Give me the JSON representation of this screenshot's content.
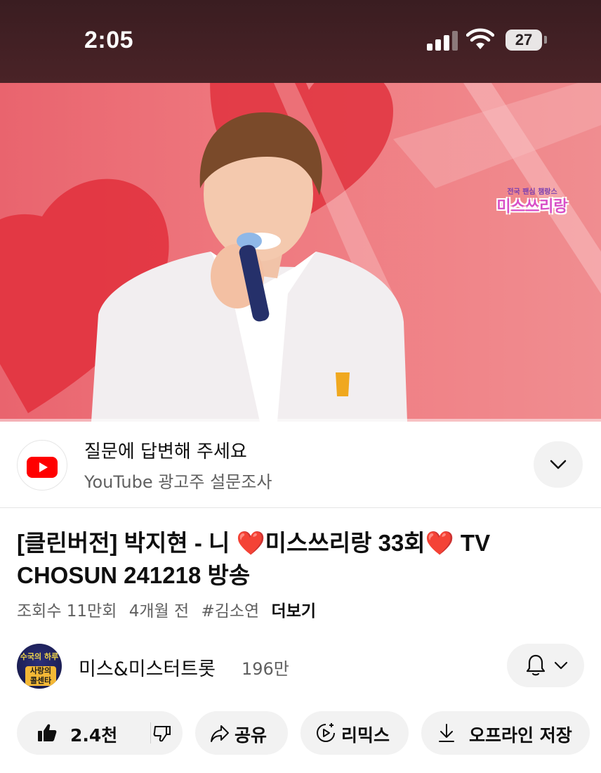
{
  "status_bar": {
    "time": "2:05",
    "battery": "27"
  },
  "video": {
    "channel_logo_sub": "전국 팬심 챔랑스",
    "channel_logo_main": "미스쓰리랑"
  },
  "survey": {
    "title": "질문에 답변해 주세요",
    "subtitle": "YouTube 광고주 설문조사"
  },
  "video_info": {
    "title_part1": "[클린버전] 박지현 - 니 ",
    "heart1": "❤️",
    "title_part2": "미스쓰리랑 33회",
    "heart2": "❤️",
    "title_part3": " TV CHOSUN 241218 방송",
    "views": "조회수 11만회",
    "age": "4개월 전",
    "hashtag": "#김소연",
    "more": "더보기"
  },
  "channel": {
    "avatar_text1": "수국의 하루",
    "avatar_text2": "사랑의 콜센타",
    "name": "미스&미스터트롯",
    "subscribers": "196만"
  },
  "actions": {
    "like_count": "2.4천",
    "share": "공유",
    "remix": "리믹스",
    "download": "오프라인 저장"
  },
  "colors": {
    "status_bg": "#41201f",
    "youtube_red": "#ff0000",
    "button_bg": "#f2f2f2",
    "heart": "#e02424"
  }
}
